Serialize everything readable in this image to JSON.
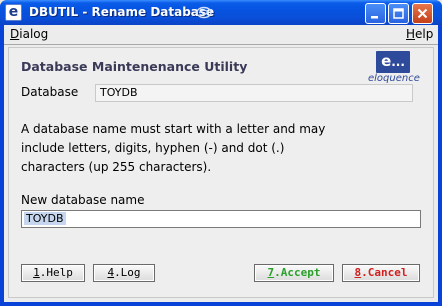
{
  "window": {
    "icon_letter": "e",
    "title": "DBUTIL - Rename Database"
  },
  "menu": {
    "dialog_first": "D",
    "dialog_rest": "ialog",
    "help_first": "H",
    "help_rest": "elp"
  },
  "panel": {
    "heading": "Database Maintenenance Utility",
    "logo": {
      "letter": "e",
      "dots": "...",
      "text": "eloquence"
    },
    "database_label": "Database",
    "database_value": "TOYDB",
    "info_lines": [
      "A database name must start with a letter and may",
      "include letters, digits, hyphen (-) and dot (.)",
      "characters (up 255 characters)."
    ],
    "new_name_label": "New database name",
    "new_name_value": "TOYDB"
  },
  "buttons": {
    "help": {
      "key": "1",
      "label": ".Help"
    },
    "log": {
      "key": "4",
      "label": ".Log"
    },
    "accept": {
      "key": "7",
      "label": ".Accept"
    },
    "cancel": {
      "key": "8",
      "label": ".Cancel"
    }
  },
  "colors": {
    "titlebar": "#0a5ce8",
    "accept": "#2aa02a",
    "cancel": "#d02020",
    "logo": "#2e4a9a"
  }
}
